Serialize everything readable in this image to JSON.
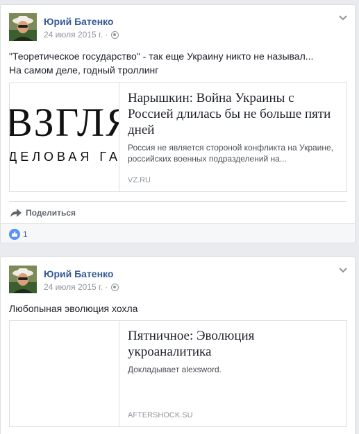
{
  "posts": [
    {
      "author": "Юрий Батенко",
      "date": "24 июля 2015 г.",
      "dot": "·",
      "text_lines": [
        "\"Теоретическое государство\" - так еще Украину никто не называл...",
        "На самом деле, годный троллинг"
      ],
      "link": {
        "thumb_logo": "ВЗГЛЯ",
        "thumb_sub": "ДЕЛОВАЯ ГАЗЕТА",
        "title": "Нарышкин: Война Украины с Россией длилась бы не больше пяти дней",
        "description": "Россия не является стороной конфликта на Украине, российских военных подразделений на...",
        "domain": "VZ.RU"
      },
      "share_label": "Поделиться",
      "likes": "1"
    },
    {
      "author": "Юрий Батенко",
      "date": "24 июля 2015 г.",
      "dot": "·",
      "text_lines": [
        "Любопыная эволюция хохла"
      ],
      "link": {
        "title": "Пятничное: Эволюция укроаналитика",
        "description": "Докладывает alexsword.",
        "domain": "AFTERSHOCK.SU"
      }
    }
  ],
  "colors": {
    "link_blue": "#365899",
    "like_blue": "#5890ff",
    "meta_gray": "#90949c"
  }
}
